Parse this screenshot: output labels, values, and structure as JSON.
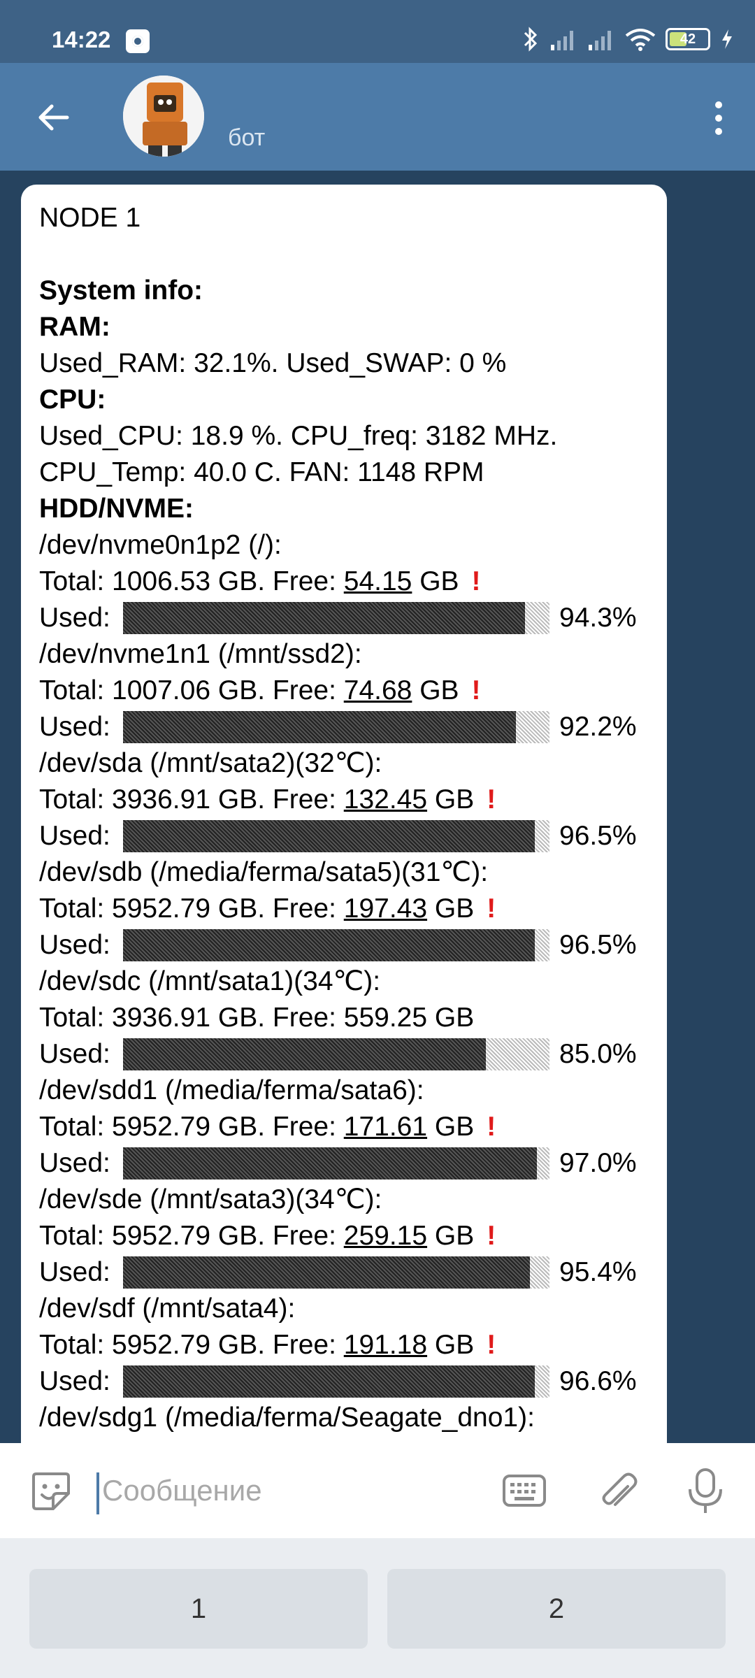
{
  "status_bar": {
    "time": "14:22",
    "battery_percent": "42",
    "icons": [
      "bluetooth-icon",
      "signal-icon",
      "signal-icon",
      "wifi-icon",
      "battery-icon",
      "charging-icon"
    ]
  },
  "header": {
    "title": "бот"
  },
  "message": {
    "node": "NODE 1",
    "system_info": "System info:",
    "ram_heading": "RAM:",
    "ram_line": "Used_RAM: 32.1%. Used_SWAP: 0 %",
    "cpu_heading": "CPU:",
    "cpu_line1": "Used_CPU: 18.9 %. CPU_freq: 3182 MHz.",
    "cpu_line2": "CPU_Temp: 40.0 C. FAN: 1148 RPM",
    "hdd_heading": "HDD/NVME:",
    "used_label": "Used:",
    "disks": [
      {
        "name": "/dev/nvme0n1p2 (/):",
        "total": "Total: 1006.53 GB. Free: ",
        "free": "54.15",
        "unit": " GB",
        "warn": "!",
        "used_fraction": 0.943,
        "percent": "94.3%"
      },
      {
        "name": "/dev/nvme1n1 (/mnt/ssd2):",
        "total": "Total: 1007.06 GB. Free: ",
        "free": "74.68",
        "unit": " GB",
        "warn": "!",
        "used_fraction": 0.922,
        "percent": "92.2%"
      },
      {
        "name": "/dev/sda (/mnt/sata2)(32℃):",
        "total": "Total: 3936.91 GB. Free: ",
        "free": "132.45",
        "unit": " GB",
        "warn": "!",
        "used_fraction": 0.965,
        "percent": "96.5%"
      },
      {
        "name": "/dev/sdb (/media/ferma/sata5)(31℃):",
        "total": "Total: 5952.79 GB. Free: ",
        "free": "197.43",
        "unit": " GB",
        "warn": "!",
        "used_fraction": 0.965,
        "percent": "96.5%"
      },
      {
        "name": "/dev/sdc (/mnt/sata1)(34℃):",
        "total": "Total: 3936.91 GB. Free: ",
        "free": "559.25",
        "unit": " GB",
        "warn": "",
        "used_fraction": 0.85,
        "percent": "85.0%"
      },
      {
        "name": "/dev/sdd1 (/media/ferma/sata6):",
        "total": "Total: 5952.79 GB. Free: ",
        "free": "171.61",
        "unit": " GB",
        "warn": "!",
        "used_fraction": 0.97,
        "percent": "97.0%"
      },
      {
        "name": "/dev/sde (/mnt/sata3)(34℃):",
        "total": "Total: 5952.79 GB. Free: ",
        "free": "259.15",
        "unit": " GB",
        "warn": "!",
        "used_fraction": 0.954,
        "percent": "95.4%"
      },
      {
        "name": "/dev/sdf (/mnt/sata4):",
        "total": "Total: 5952.79 GB. Free: ",
        "free": "191.18",
        "unit": " GB",
        "warn": "!",
        "used_fraction": 0.966,
        "percent": "96.6%"
      }
    ],
    "last_disk_name": "/dev/sdg1 (/media/ferma/Seagate_dno1):"
  },
  "input": {
    "placeholder": "Сообщение"
  },
  "keyboard": {
    "buttons": [
      "1",
      "2"
    ]
  }
}
